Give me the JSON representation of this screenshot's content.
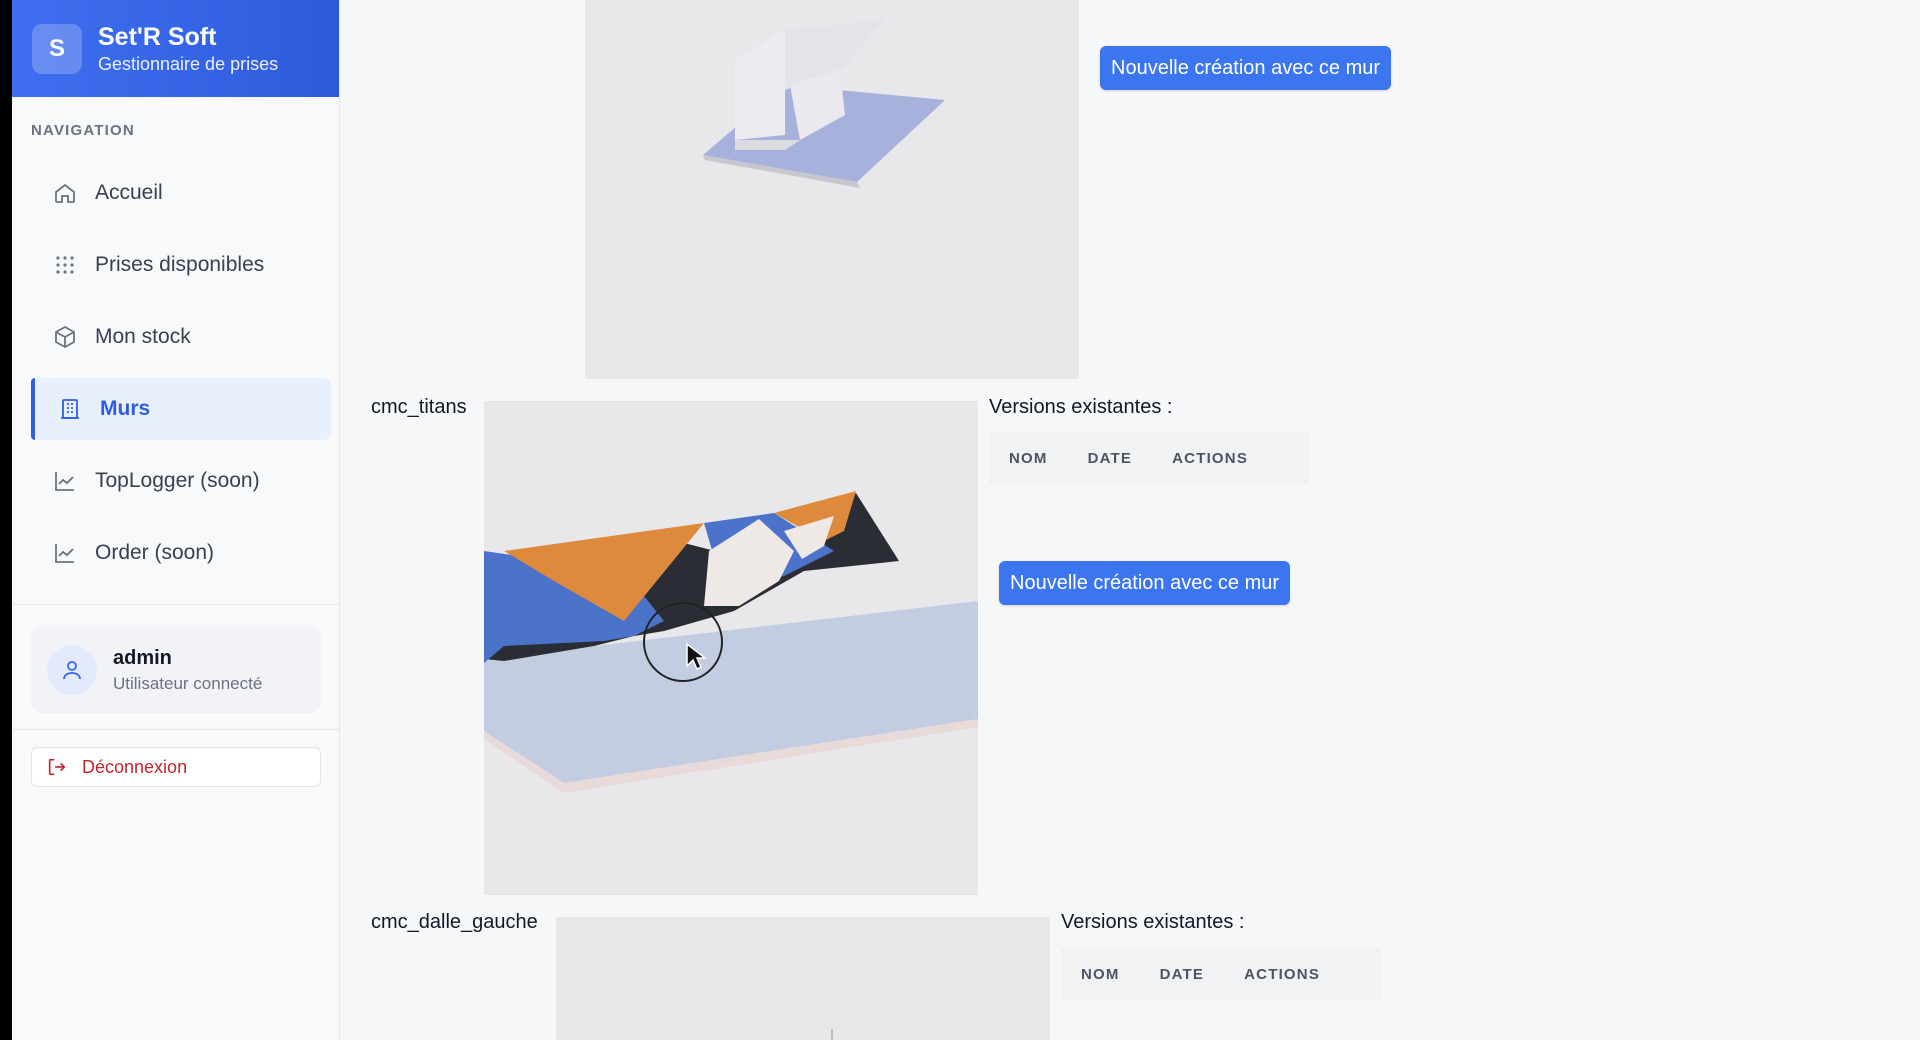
{
  "brand": {
    "logo_letter": "S",
    "title": "Set'R Soft",
    "subtitle": "Gestionnaire de prises"
  },
  "nav_heading": "NAVIGATION",
  "nav_items": [
    {
      "label": "Accueil",
      "icon": "home-icon",
      "active": false
    },
    {
      "label": "Prises disponibles",
      "icon": "grid-dots-icon",
      "active": false
    },
    {
      "label": "Mon stock",
      "icon": "box-icon",
      "active": false
    },
    {
      "label": "Murs",
      "icon": "building-icon",
      "active": true
    },
    {
      "label": "TopLogger (soon)",
      "icon": "chart-line-icon",
      "active": false
    },
    {
      "label": "Order (soon)",
      "icon": "chart-line-icon",
      "active": false
    }
  ],
  "user": {
    "name": "admin",
    "role": "Utilisateur connecté",
    "icon": "user-icon"
  },
  "logout_label": "Déconnexion",
  "walls": [
    {
      "name": "",
      "versions_title": "",
      "columns": [],
      "new_button": "Nouvelle création avec ce mur"
    },
    {
      "name": "cmc_titans",
      "versions_title": "Versions existantes :",
      "columns": [
        "NOM",
        "DATE",
        "ACTIONS"
      ],
      "new_button": "Nouvelle création avec ce mur"
    },
    {
      "name": "cmc_dalle_gauche",
      "versions_title": "Versions existantes :",
      "columns": [
        "NOM",
        "DATE",
        "ACTIONS"
      ],
      "new_button": ""
    }
  ],
  "colors": {
    "accent": "#3b75f0",
    "active_nav": "#2f5fe0",
    "logout": "#c0262d",
    "wall_orange": "#de8a3c",
    "wall_blue": "#4a73c9",
    "wall_floor": "#c3cde2"
  }
}
